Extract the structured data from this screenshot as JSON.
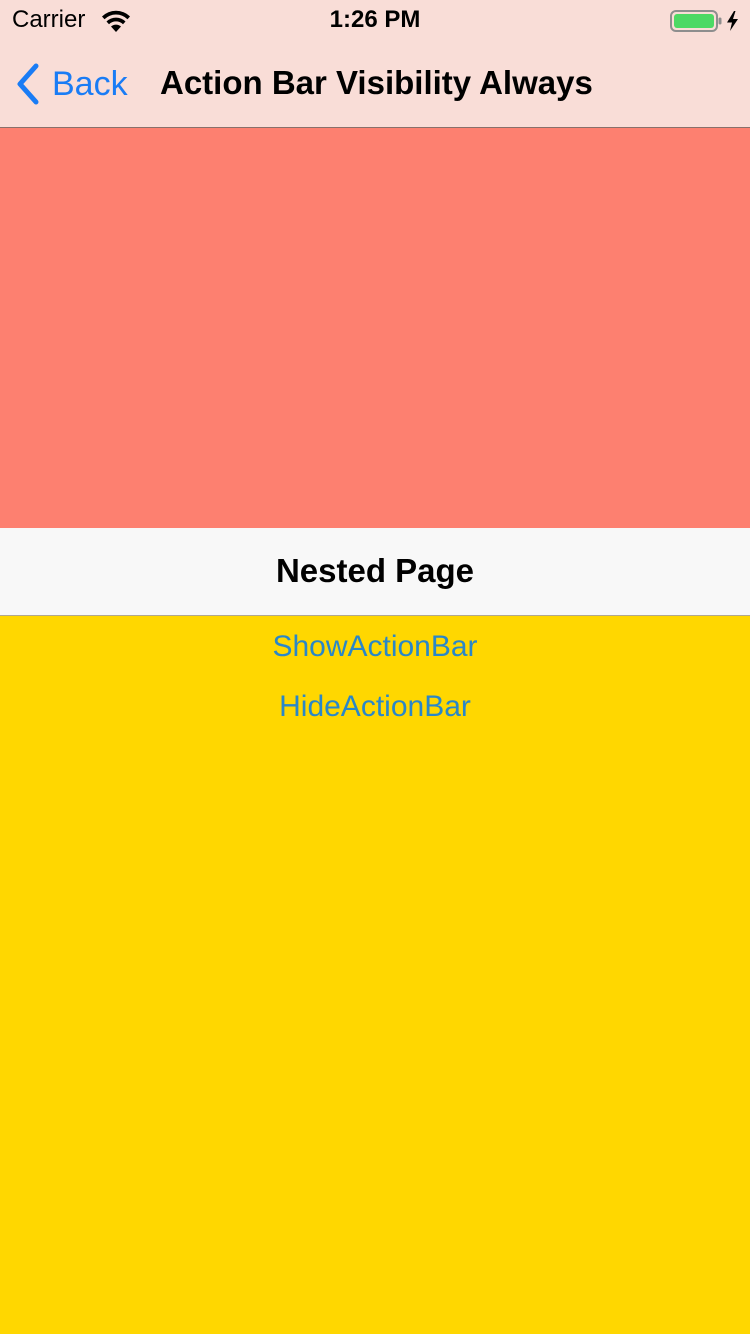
{
  "status_bar": {
    "carrier": "Carrier",
    "time": "1:26 PM",
    "wifi_icon": "wifi-icon",
    "battery_icon": "battery-charging-icon",
    "battery_color": "#4cd964"
  },
  "nav_bar": {
    "back_label": "Back",
    "back_icon": "chevron-left-icon",
    "title": "Action Bar Visibility Always",
    "background": "#f9ddd7",
    "accent": "#1a7cf5"
  },
  "content": {
    "salmon_block_color": "#fd8070",
    "background_color": "#ffd700"
  },
  "nested_page": {
    "title": "Nested Page",
    "buttons": {
      "show_label": "ShowActionBar",
      "hide_label": "HideActionBar"
    },
    "button_color": "#2a87c8"
  }
}
